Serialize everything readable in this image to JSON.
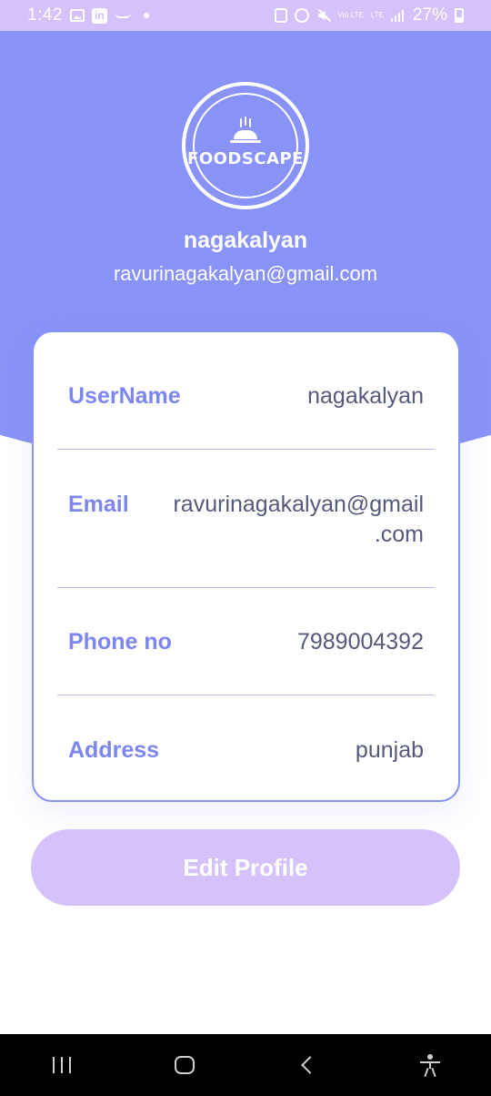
{
  "status_bar": {
    "time": "1:42",
    "battery_percent": "27%",
    "volte_label": "Vo) LTE",
    "lte_label": "LTE",
    "linkedin_label": "in"
  },
  "header": {
    "logo_text": "FOODSCAPE",
    "name": "nagakalyan",
    "email": "ravurinagakalyan@gmail.com"
  },
  "details": {
    "username": {
      "label": "UserName",
      "value": "nagakalyan"
    },
    "email": {
      "label": "Email",
      "value_line1": "ravurinagakalyan@gmail",
      "value_line2": ".com"
    },
    "phone": {
      "label": "Phone no",
      "value": "7989004392"
    },
    "address": {
      "label": "Address",
      "value": "punjab"
    }
  },
  "actions": {
    "edit_profile_label": "Edit Profile"
  },
  "colors": {
    "header_purple": "#8892f7",
    "button_lavender": "#d5c2fb",
    "label_purple": "#7c86ee",
    "value_gray": "#55597a"
  },
  "icons": {
    "status_bar": [
      "gallery-icon",
      "linkedin-icon",
      "dash-icon",
      "dot-icon",
      "clipboard-icon",
      "alarm-icon",
      "mute-icon",
      "signal-icon",
      "battery-icon"
    ],
    "nav_bar": [
      "recents-icon",
      "home-icon",
      "back-icon",
      "accessibility-icon"
    ],
    "logo": "cloche-icon"
  }
}
